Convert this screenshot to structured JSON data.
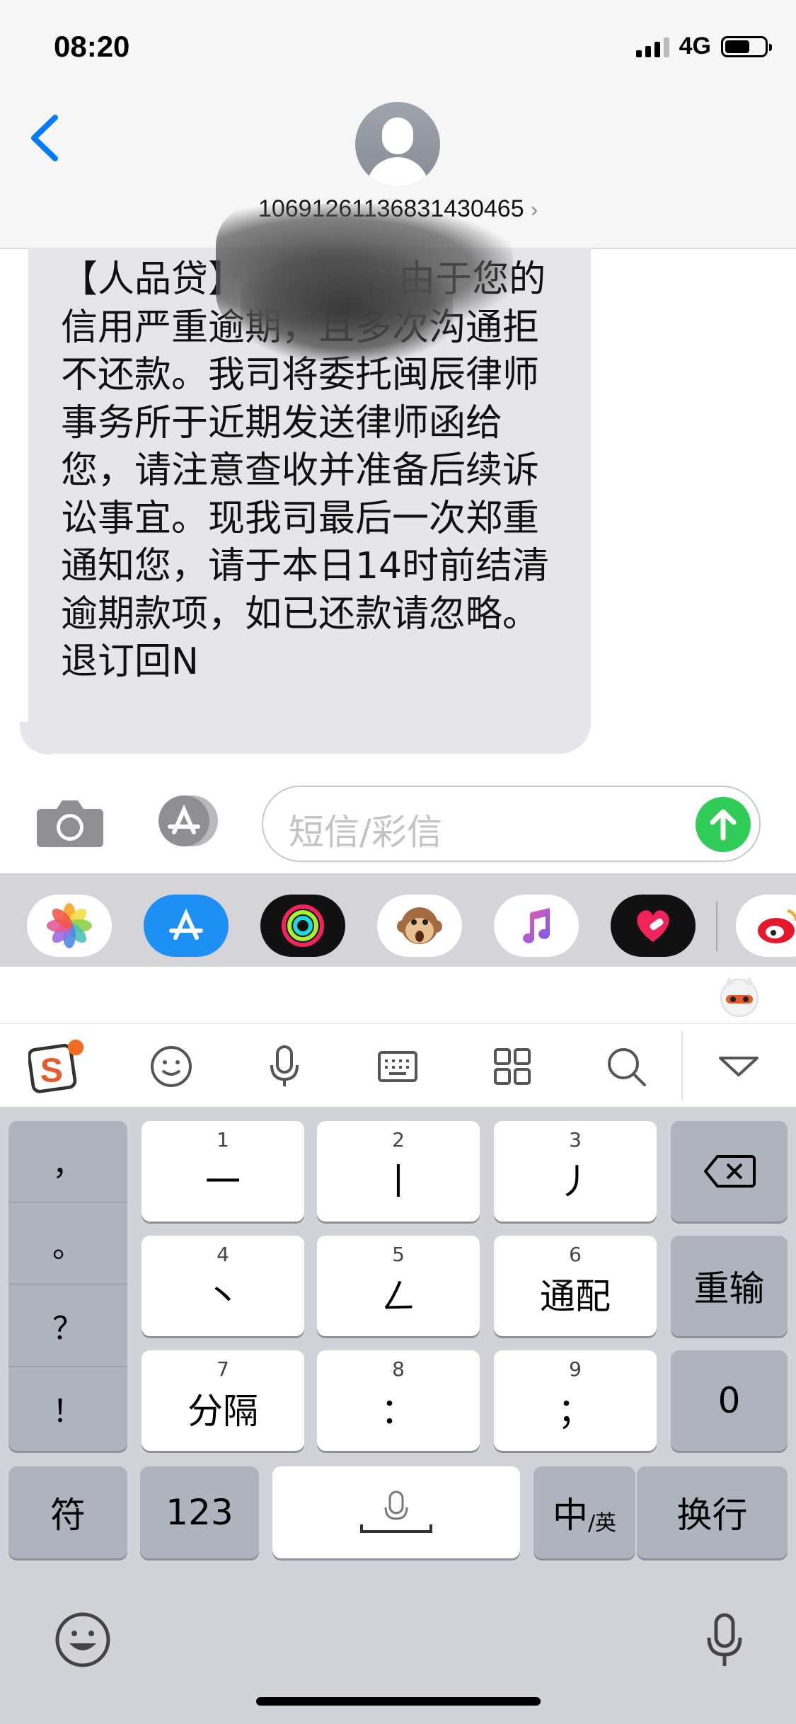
{
  "status_bar": {
    "time": "08:20",
    "network": "4G"
  },
  "header": {
    "contact": "10691261136831430465",
    "chevron": "›"
  },
  "message": {
    "text": "【人品贷】          ，由于您的信用严重逾期，且多次沟通拒不还款。我司将委托闽辰律师事务所于近期发送律师函给您，请注意查收并准备后续诉讼事宜。现我司最后一次郑重通知您，请于本日14时前结清逾期款项，如已还款请忽略。 退订回N"
  },
  "compose": {
    "placeholder": "短信/彩信"
  },
  "app_strip": {
    "apps": [
      "photos-icon",
      "app-store-icon",
      "activity-icon",
      "animoji-icon",
      "music-icon",
      "heart-app-icon",
      "weibo-icon"
    ]
  },
  "keyboard": {
    "punct": [
      "，",
      "。",
      "？",
      "！"
    ],
    "rows": [
      [
        {
          "num": "1",
          "label": "一"
        },
        {
          "num": "2",
          "label": "丨"
        },
        {
          "num": "3",
          "label": "丿"
        }
      ],
      [
        {
          "num": "4",
          "label": "丶"
        },
        {
          "num": "5",
          "label": "ㄥ"
        },
        {
          "num": "6",
          "label": "通配"
        }
      ],
      [
        {
          "num": "7",
          "label": "分隔"
        },
        {
          "num": "8",
          "label": "："
        },
        {
          "num": "9",
          "label": "；"
        }
      ]
    ],
    "side": {
      "reenter": "重输",
      "zero": "0"
    },
    "bottom": {
      "symbols": "符",
      "numbers": "123",
      "lang_main": "中",
      "lang_sub": "/英",
      "return": "换行"
    }
  },
  "colors": {
    "accent": "#007aff",
    "send": "#2fcc57",
    "bubble": "#e5e5ea"
  }
}
